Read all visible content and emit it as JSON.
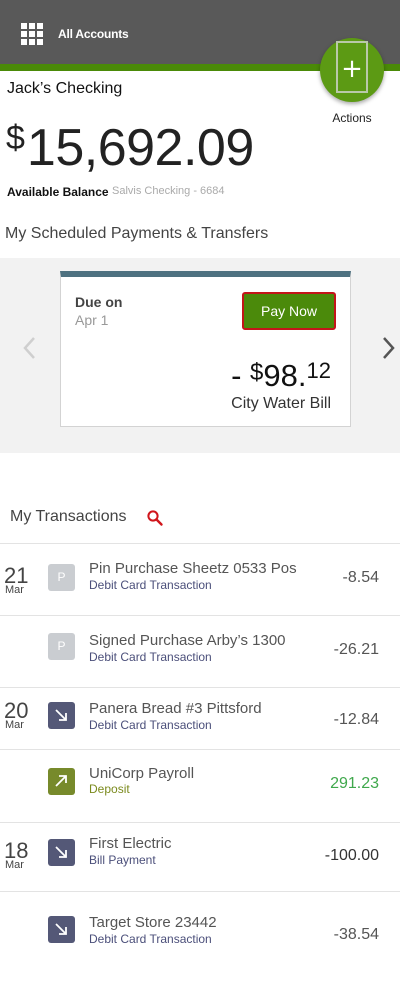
{
  "header": {
    "title": "All Accounts",
    "grid_icon": "apps-grid-icon",
    "colors": {
      "bar": "#595959",
      "stripe": "#4a8a08"
    }
  },
  "fab": {
    "symbol": "+",
    "label": "Actions",
    "color": "#5c9a14"
  },
  "account": {
    "name": "Jack’s Checking",
    "balance_currency": "$",
    "balance_amount": "15,692.09",
    "available_label": "Available Balance",
    "account_sub": "Salvis Checking - 6684"
  },
  "scheduled": {
    "title": "My Scheduled Payments & Transfers",
    "card": {
      "due_label": "Due on",
      "due_date": "Apr 1",
      "pay_button": "Pay Now",
      "amount_sign": "- ",
      "amount_currency": "$",
      "amount_dollars": "98.",
      "amount_cents": "12",
      "payee": "City Water Bill"
    }
  },
  "transactions": {
    "title": "My Transactions",
    "items": [
      {
        "day": "21",
        "month": "Mar",
        "badge": "P",
        "name": "Pin Purchase Sheetz 0533 Pos",
        "type": "Debit Card Transaction",
        "amount": "-8.54"
      },
      {
        "day": "",
        "month": "",
        "badge": "P",
        "name": "Signed Purchase Arby’s 1300",
        "type": "Debit Card Transaction",
        "amount": "-26.21"
      },
      {
        "day": "20",
        "month": "Mar",
        "badge": "outgoing-arrow-icon",
        "name": "Panera Bread #3 Pittsford",
        "type": "Debit Card Transaction",
        "amount": "-12.84"
      },
      {
        "day": "",
        "month": "",
        "badge": "incoming-arrow-icon",
        "name": "UniCorp Payroll",
        "type": "Deposit",
        "amount": "291.23"
      },
      {
        "day": "18",
        "month": "Mar",
        "badge": "outgoing-arrow-icon",
        "name": "First Electric",
        "type": "Bill Payment",
        "amount": "-100.00"
      },
      {
        "day": "",
        "month": "",
        "badge": "outgoing-arrow-icon",
        "name": "Target Store 23442",
        "type": "Debit Card Transaction",
        "amount": "-38.54"
      }
    ]
  }
}
